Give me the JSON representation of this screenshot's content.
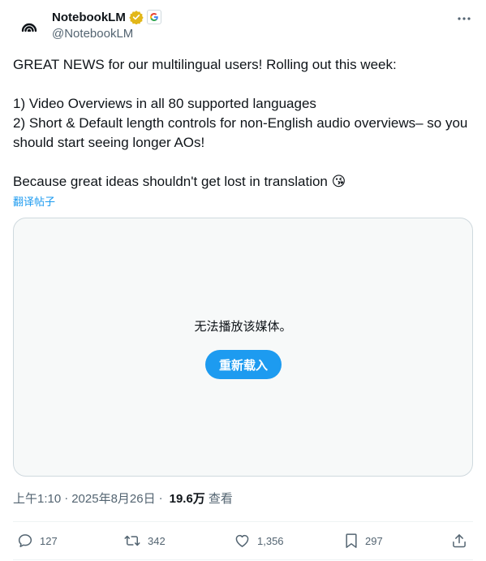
{
  "author": {
    "display_name": "NotebookLM",
    "handle": "@NotebookLM",
    "avatar_icon": "notebooklm-logo-icon",
    "verified_icon": "gold-verified-badge-icon",
    "affiliate_icon": "google-g-icon"
  },
  "post": {
    "line1": "GREAT NEWS for our multilingual users! Rolling out this week:",
    "line2": "1) Video Overviews in all 80 supported languages",
    "line3": "2) Short & Default length controls for non-English audio overviews– so you should start seeing longer AOs!",
    "line4": "Because great ideas shouldn't get lost in translation 😘",
    "translate_label": "翻译帖子"
  },
  "media": {
    "error_message": "无法播放该媒体。",
    "reload_label": "重新载入"
  },
  "meta": {
    "time": "上午1:10",
    "separator": "·",
    "date": "2025年8月26日",
    "views_count": "19.6万",
    "views_label": "查看"
  },
  "actions": {
    "replies": "127",
    "reposts": "342",
    "likes": "1,356",
    "bookmarks": "297"
  },
  "colors": {
    "accent": "#1d9bf0",
    "secondary_text": "#536471",
    "primary_text": "#0f1419",
    "verified_gold": "#e2b719"
  }
}
